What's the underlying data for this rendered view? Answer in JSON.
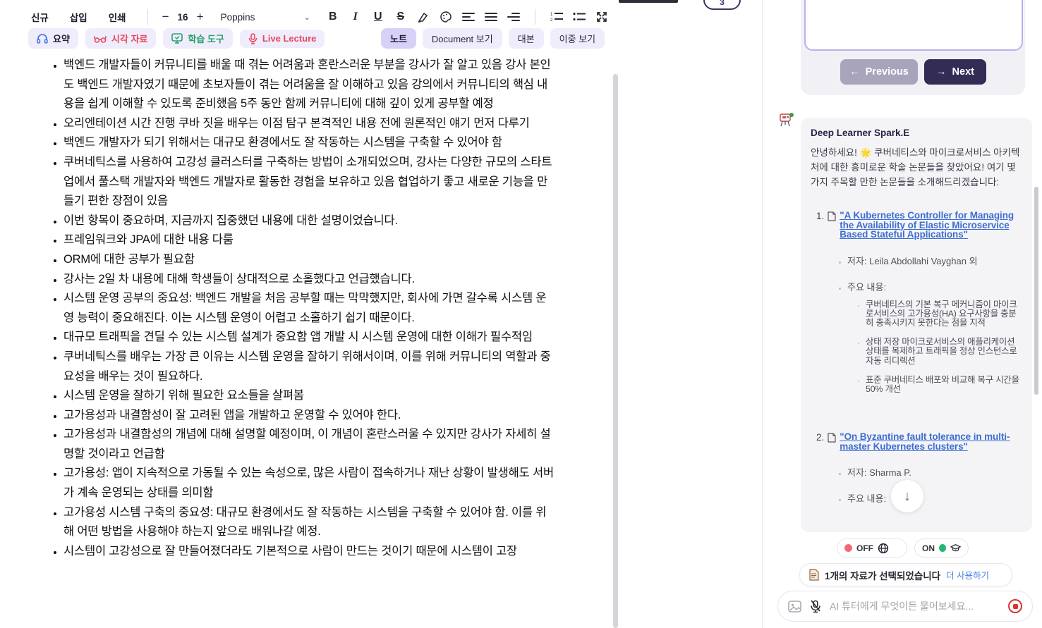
{
  "toolbar": {
    "menu": [
      "신규",
      "삽입",
      "인쇄"
    ],
    "font_size_decrease": "−",
    "font_size": "16",
    "font_size_increase": "+",
    "font_name": "Poppins",
    "chevron": "⌄",
    "format": {
      "bold": "B",
      "italic": "I",
      "underline": "U",
      "strikethrough": "S"
    }
  },
  "action_buttons": {
    "summary": "요약",
    "visual_materials": "시각 자료",
    "learning_tools": "학습 도구",
    "live_lecture": "Live Lecture"
  },
  "view_tabs": [
    {
      "label": "노트",
      "active": true
    },
    {
      "label": "Document 보기",
      "active": false
    },
    {
      "label": "대본",
      "active": false
    },
    {
      "label": "이중 보기",
      "active": false
    }
  ],
  "page_badge": "3",
  "doc": {
    "bullets": [
      "백엔드 개발자들이 커뮤니티를 배울 때 겪는 어려움과 혼란스러운 부분을 강사가 잘 알고 있음 강사 본인도 백엔드 개발자였기 때문에 초보자들이 겪는 어려움을 잘 이해하고 있음 강의에서 커뮤니티의 핵심 내용을 쉽게 이해할 수 있도록 준비했음 5주 동안 함께 커뮤니티에 대해 깊이 있게 공부할 예정",
      "오리엔테이션 시간 진행 쿠바 짓을 배우는 이점 탐구 본격적인 내용 전에 원론적인 얘기 먼저 다루기",
      "백엔드 개발자가 되기 위해서는 대규모 환경에서도 잘 작동하는 시스템을 구축할 수 있어야 함",
      "쿠버네틱스를 사용하여 고강성 클러스터를 구축하는 방법이 소개되었으며, 강사는 다양한 규모의 스타트업에서 풀스택 개발자와 백엔드 개발자로 활동한 경험을 보유하고 있음 협업하기 좋고 새로운 기능을 만들기 편한 장점이 있음",
      "이번 항목이 중요하며, 지금까지 집중했던 내용에 대한 설명이었습니다.",
      "프레임워크와 JPA에 대한 내용 다룸",
      "ORM에 대한 공부가 필요함",
      "강사는 2일 차 내용에 대해 학생들이 상대적으로 소홀했다고 언급했습니다.",
      "시스템 운영 공부의 중요성: 백엔드 개발을 처음 공부할 때는 막막했지만, 회사에 가면 갈수록 시스템 운영 능력이 중요해진다. 이는 시스템 운영이 어렵고 소홀하기 쉽기 때문이다.",
      "대규모 트래픽을 견딜 수 있는 시스템 설계가 중요함 앱 개발 시 시스템 운영에 대한 이해가 필수적임",
      "쿠버네틱스를 배우는 가장 큰 이유는 시스템 운영을 잘하기 위해서이며, 이를 위해 커뮤니티의 역할과 중요성을 배우는 것이 필요하다.",
      "시스템 운영을 잘하기 위해 필요한 요소들을 살펴봄",
      "고가용성과 내결함성이 잘 고려된 앱을 개발하고 운영할 수 있어야 한다.",
      "고가용성과 내결함성의 개념에 대해 설명할 예정이며, 이 개념이 혼란스러울 수 있지만 강사가 자세히 설명할 것이라고 언급함",
      "고가용성: 앱이 지속적으로 가동될 수 있는 속성으로, 많은 사람이 접속하거나 재난 상황이 발생해도 서버가 계속 운영되는 상태를 의미함",
      "고가용성 시스템 구축의 중요성: 대규모 환경에서도 잘 작동하는 시스템을 구축할 수 있어야 함. 이를 위해 어떤 방법을 사용해야 하는지 앞으로 배워나갈 예정.",
      "시스템이 고강성으로 잘 만들어졌더라도 기본적으로 사람이 만드는 것이기 때문에 시스템이 고장"
    ]
  },
  "panel": {
    "previous_label": "Previous",
    "previous_arrow": "←",
    "next_label": "Next",
    "next_arrow": "→",
    "scroll_down_arrow": "↓",
    "chat": {
      "sender": "Deep Learner Spark.E",
      "intro": "안녕하세요! 🌟 쿠버네티스와 마이크로서비스 아키텍처에 대한 흥미로운 학술 논문들을 찾았어요! 여기 몇 가지 주목할 만한 논문들을 소개해드리겠습니다:",
      "papers": [
        {
          "num": "1.",
          "title": "\"A Kubernetes Controller for Managing the Availability of Elastic Microservice Based Stateful Applications\"",
          "author": "저자: Leila Abdollahi Vayghan 외",
          "content_label": "주요 내용:",
          "points": [
            "쿠버네티스의 기본 복구 메커니즘이 마이크로서비스의 고가용성(HA) 요구사항을 충분히 충족시키지 못한다는 점을 지적",
            "상태 저장 마이크로서비스의 애플리케이션 상태를 복제하고 트래픽을 정상 인스턴스로 자동 리디렉션",
            "표준 쿠버네티스 배포와 비교해 복구 시간을 50% 개선"
          ]
        },
        {
          "num": "2.",
          "title": "\"On Byzantine fault tolerance in multi-master Kubernetes clusters\"",
          "author": "저자: Sharma P.",
          "content_label": "주요 내용:"
        }
      ]
    },
    "toggles": {
      "web_state": "OFF",
      "tutor_state": "ON"
    },
    "source_bar": {
      "text": "1개의 자료가 선택되었습니다",
      "action": "더 사용하기"
    },
    "input": {
      "placeholder": "AI 튜터에게 무엇이든 물어보세요..."
    }
  },
  "colors": {
    "accent_purple": "#d7d1f7",
    "link_blue": "#3d6ed0",
    "live_red": "#e8465f",
    "tool_green": "#27a06c",
    "next_navy": "#332c55",
    "record_red": "#d93434"
  }
}
